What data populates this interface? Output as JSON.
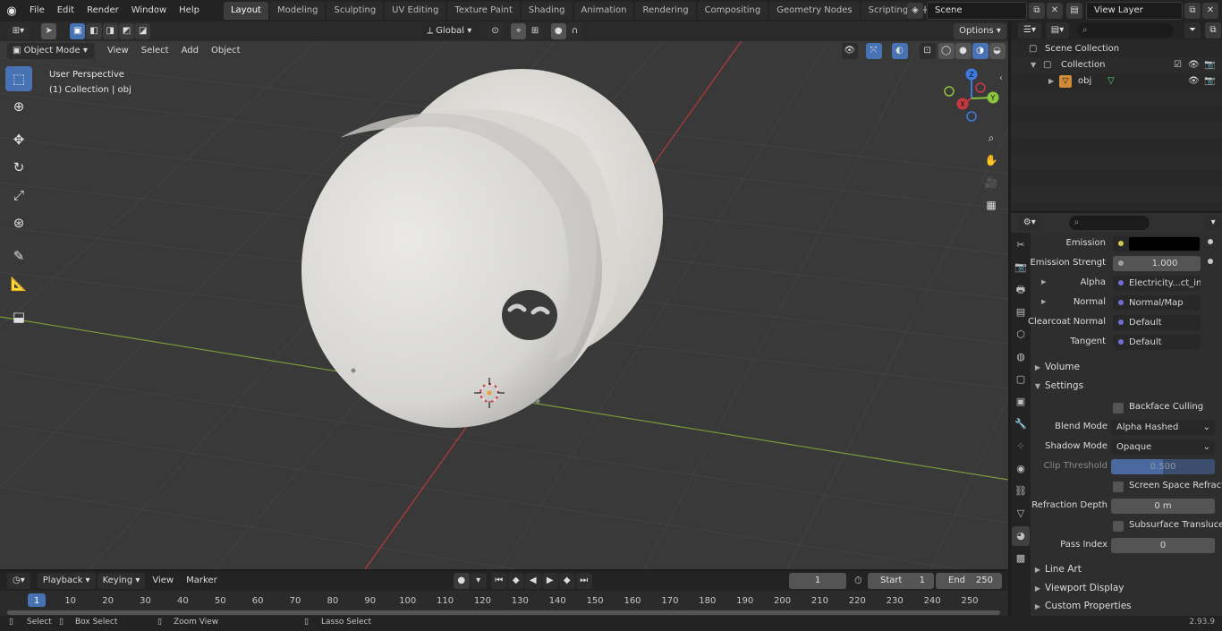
{
  "topbar": {
    "menus": [
      "File",
      "Edit",
      "Render",
      "Window",
      "Help"
    ],
    "workspaces": [
      "Layout",
      "Modeling",
      "Sculpting",
      "UV Editing",
      "Texture Paint",
      "Shading",
      "Animation",
      "Rendering",
      "Compositing",
      "Geometry Nodes",
      "Scripting"
    ],
    "active_workspace": "Layout",
    "add_workspace": "+",
    "scene": "Scene",
    "view_layer": "View Layer"
  },
  "viewport": {
    "mode": "Object Mode",
    "menus": [
      "View",
      "Select",
      "Add",
      "Object"
    ],
    "transform_orientation": "Global",
    "options": "Options",
    "info_line1": "User Perspective",
    "info_line2": "(1) Collection | obj",
    "gizmo_axes": {
      "z": "Z",
      "y": "Y",
      "x": "X"
    }
  },
  "outliner": {
    "scene_collection": "Scene Collection",
    "collection": "Collection",
    "object": "obj"
  },
  "properties": {
    "rows": [
      {
        "label": "Emission",
        "value": "",
        "socket_color": "#d6c94a",
        "kind": "color"
      },
      {
        "label": "Emission Strengt",
        "value": "1.000",
        "socket_color": "#a0a0a0",
        "kind": "num"
      },
      {
        "label": "Alpha",
        "value": "Electricity...ct_inv.png",
        "socket_color": "#6f6fd4",
        "kind": "field",
        "expand": true
      },
      {
        "label": "Normal",
        "value": "Normal/Map",
        "socket_color": "#6f6fd4",
        "kind": "field",
        "expand": true
      },
      {
        "label": "Clearcoat Normal",
        "value": "Default",
        "socket_color": "#6f6fd4",
        "kind": "field"
      },
      {
        "label": "Tangent",
        "value": "Default",
        "socket_color": "#6f6fd4",
        "kind": "field"
      }
    ],
    "sections": {
      "volume": "Volume",
      "settings": "Settings",
      "line_art": "Line Art",
      "viewport_display": "Viewport Display",
      "custom_properties": "Custom Properties"
    },
    "settings": {
      "backface_culling": "Backface Culling",
      "blend_mode_label": "Blend Mode",
      "blend_mode": "Alpha Hashed",
      "shadow_mode_label": "Shadow Mode",
      "shadow_mode": "Opaque",
      "clip_threshold_label": "Clip Threshold",
      "clip_threshold": "0.500",
      "screen_space_refraction": "Screen Space Refraction",
      "refraction_depth_label": "Refraction Depth",
      "refraction_depth": "0 m",
      "subsurface_translucency": "Subsurface Translucency",
      "pass_index_label": "Pass Index",
      "pass_index": "0"
    }
  },
  "timeline": {
    "menus": [
      "Playback",
      "Keying",
      "View",
      "Marker"
    ],
    "current_frame": "1",
    "start_label": "Start",
    "start": "1",
    "end_label": "End",
    "end": "250",
    "ticks": [
      "1",
      "10",
      "20",
      "30",
      "40",
      "50",
      "60",
      "70",
      "80",
      "90",
      "100",
      "110",
      "120",
      "130",
      "140",
      "150",
      "160",
      "170",
      "180",
      "190",
      "200",
      "210",
      "220",
      "230",
      "240",
      "250"
    ]
  },
  "statusbar": {
    "select": "Select",
    "box_select": "Box Select",
    "zoom_view": "Zoom View",
    "lasso_select": "Lasso Select",
    "version": "2.93.9"
  },
  "colors": {
    "accent": "#4772b3",
    "axis_x": "#c8383f",
    "axis_y": "#8bc43f",
    "axis_z": "#3d7be0"
  }
}
